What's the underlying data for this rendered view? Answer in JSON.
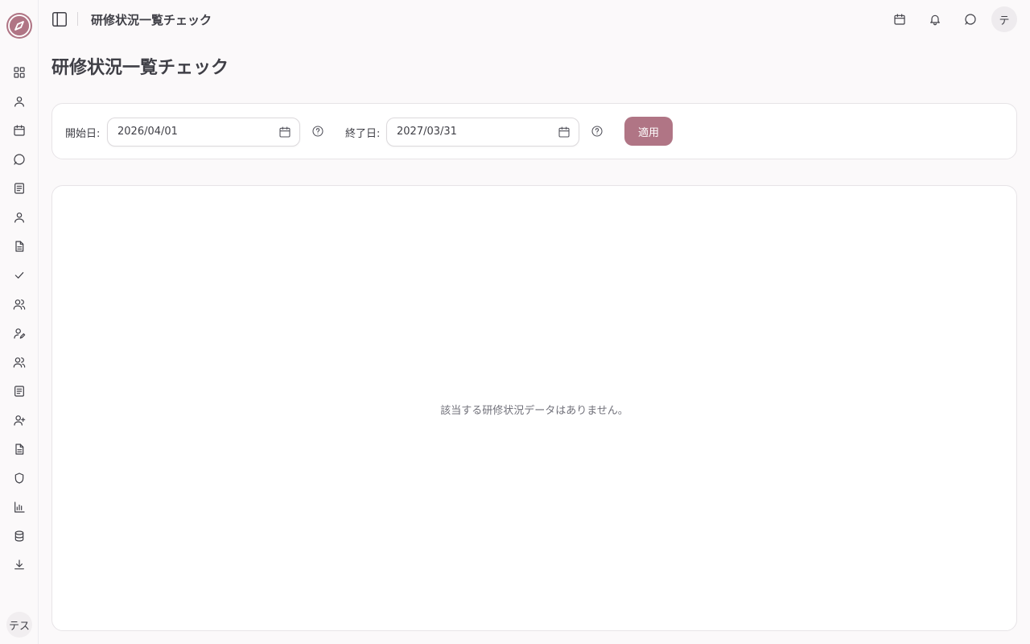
{
  "header": {
    "title": "研修状況一覧チェック",
    "avatar_initial": "テ"
  },
  "sidebar": {
    "items": [
      {
        "icon": "dashboard-icon"
      },
      {
        "icon": "user-icon"
      },
      {
        "icon": "calendar-icon"
      },
      {
        "icon": "chat-icon"
      },
      {
        "icon": "book-icon"
      },
      {
        "icon": "user-icon"
      },
      {
        "icon": "document-icon"
      },
      {
        "icon": "check-icon"
      },
      {
        "icon": "users-icon"
      },
      {
        "icon": "user-edit-icon"
      },
      {
        "icon": "users-icon"
      },
      {
        "icon": "book-icon"
      },
      {
        "icon": "user-plus-icon"
      },
      {
        "icon": "document-icon"
      },
      {
        "icon": "shield-icon"
      },
      {
        "icon": "bar-chart-icon"
      },
      {
        "icon": "database-icon"
      },
      {
        "icon": "download-icon"
      }
    ],
    "user_label": "テス"
  },
  "main": {
    "page_title": "研修状況一覧チェック",
    "filters": {
      "start_label": "開始日:",
      "start_value": "2026/04/01",
      "end_label": "終了日:",
      "end_value": "2027/03/31",
      "apply_label": "適用"
    },
    "empty_message": "該当する研修状況データはありません。"
  },
  "colors": {
    "accent": "#b07585",
    "background": "#fbf9fa",
    "text": "#3f3f46"
  }
}
